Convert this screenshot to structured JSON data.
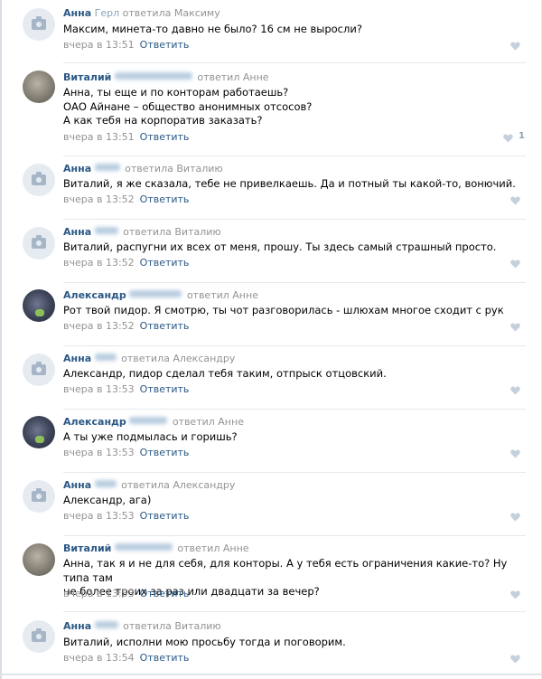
{
  "comments": [
    {
      "author": "Анна",
      "tail": "Герл",
      "action": "ответила Максиму",
      "text": [
        "Максим, минета-то давно не было? 16 см не выросли?"
      ],
      "time": "вчера в 13:51",
      "reply": "Ответить",
      "avatar": "placeholder"
    },
    {
      "author": "Виталий",
      "tail": "",
      "action": "ответил Анне",
      "text": [
        "Анна, ты еще и по конторам работаешь?",
        "ОАО Айнане – общество анонимных отсосов?",
        "А как тебя на корпоратив заказать?"
      ],
      "time": "вчера в 13:51",
      "reply": "Ответить",
      "avatar": "photo-vit",
      "likes": "1"
    },
    {
      "author": "Анна",
      "tail": "",
      "action": "ответила Виталию",
      "text": [
        "Виталий, я же сказала, тебе не привелкаешь. Да и потный ты какой-то, вонючий."
      ],
      "time": "вчера в 13:52",
      "reply": "Ответить",
      "avatar": "placeholder"
    },
    {
      "author": "Анна",
      "tail": "",
      "action": "ответила Виталию",
      "text": [
        "Виталий, распугни их всех от меня, прошу. Ты здесь самый страшный просто."
      ],
      "time": "вчера в 13:52",
      "reply": "Ответить",
      "avatar": "placeholder"
    },
    {
      "author": "Александр",
      "tail": "",
      "action": "ответил Анне",
      "text": [
        "Рот твой пидор. Я смотрю, ты чот разговорилась - шлюхам многое сходит с рук"
      ],
      "time": "вчера в 13:52",
      "reply": "Ответить",
      "avatar": "photo-alex"
    },
    {
      "author": "Анна",
      "tail": "",
      "action": "ответила Александру",
      "text": [
        "Александр, пидор сделал тебя таким, отпрыск отцовский."
      ],
      "time": "вчера в 13:53",
      "reply": "Ответить",
      "avatar": "placeholder"
    },
    {
      "author": "Александр",
      "tail": "",
      "action": "ответил Анне",
      "text": [
        "А ты уже подмылась и горишь?"
      ],
      "time": "вчера в 13:53",
      "reply": "Ответить",
      "avatar": "photo-alex"
    },
    {
      "author": "Анна",
      "tail": "",
      "action": "ответила Александру",
      "text": [
        "Александр, ага)"
      ],
      "time": "вчера в 13:53",
      "reply": "Ответить",
      "avatar": "placeholder"
    },
    {
      "author": "Виталий",
      "tail": "",
      "action": "ответил Анне",
      "text": [
        "Анна, так я и не для себя, для конторы. А у тебя есть ограничения какие-то? Ну типа там",
        "не более троих за раз или двадцати за вечер?"
      ],
      "time": "вчера в 13:53",
      "reply": "Ответить",
      "avatar": "photo-vit"
    },
    {
      "author": "Анна",
      "tail": "",
      "action": "ответила Виталию",
      "text": [
        "Виталий, исполни мою просьбу тогда и поговорим."
      ],
      "time": "вчера в 13:54",
      "reply": "Ответить",
      "avatar": "placeholder"
    }
  ]
}
